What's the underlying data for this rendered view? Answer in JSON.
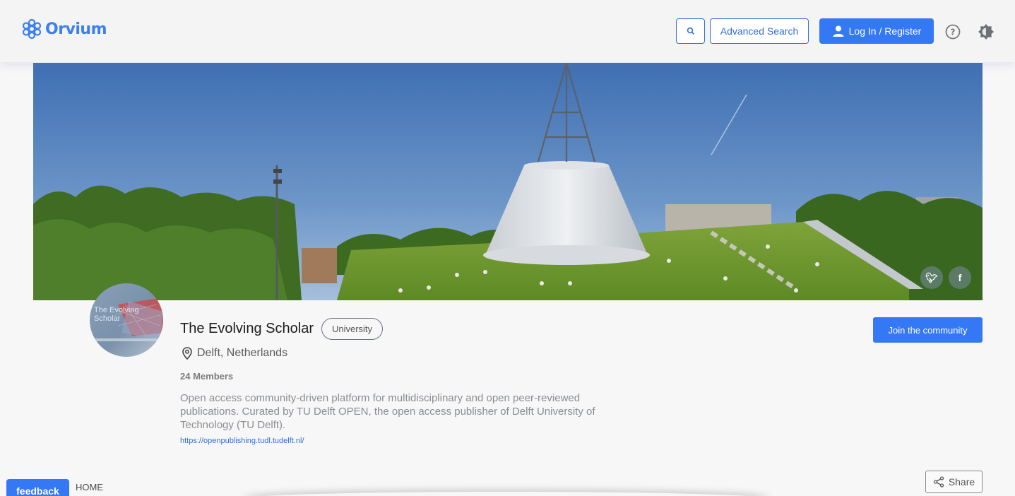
{
  "brand": {
    "name": "Orvium",
    "logo_icon": "molecule-icon"
  },
  "header": {
    "search_icon": "search-icon",
    "advanced_search_label": "Advanced Search",
    "login_label": "Log In / Register",
    "help_icon": "help-circle-icon",
    "theme_icon": "brightness-icon"
  },
  "banner": {
    "alt": "TU Delft library cone with green grass roof",
    "social": [
      "twitter-icon",
      "facebook-icon"
    ]
  },
  "community": {
    "name": "The Evolving Scholar",
    "type_badge": "University",
    "location": "Delft, Netherlands",
    "members": "24 Members",
    "description": "Open access community-driven platform for multidisciplinary and open peer-reviewed publications. Curated by TU Delft OPEN, the open access publisher of Delft University of Technology (TU Delft).",
    "url": "https://openpublishing.tudl.tudelft.nl/",
    "avatar_text": "The Evolving Scholar",
    "join_label": "Join the community"
  },
  "footer": {
    "feedback_label": "feedback",
    "breadcrumb": "HOME",
    "share_label": "Share"
  },
  "colors": {
    "accent": "#3478f6",
    "brand": "#3b7ff2"
  }
}
